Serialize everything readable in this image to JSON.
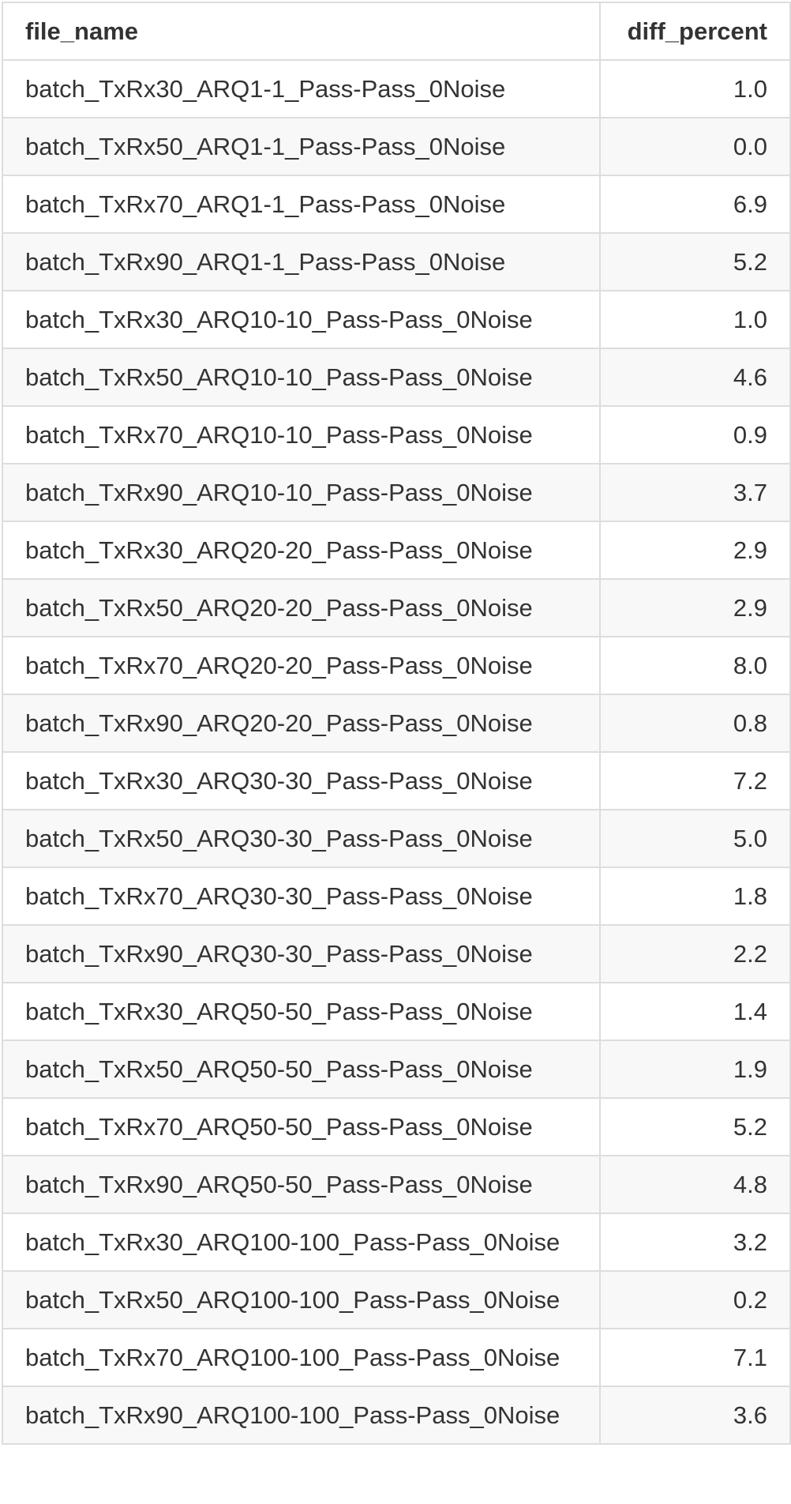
{
  "table": {
    "headers": {
      "file_name": "file_name",
      "diff_percent": "diff_percent"
    },
    "rows": [
      {
        "file_name": "batch_TxRx30_ARQ1-1_Pass-Pass_0Noise",
        "diff_percent": "1.0"
      },
      {
        "file_name": "batch_TxRx50_ARQ1-1_Pass-Pass_0Noise",
        "diff_percent": "0.0"
      },
      {
        "file_name": "batch_TxRx70_ARQ1-1_Pass-Pass_0Noise",
        "diff_percent": "6.9"
      },
      {
        "file_name": "batch_TxRx90_ARQ1-1_Pass-Pass_0Noise",
        "diff_percent": "5.2"
      },
      {
        "file_name": "batch_TxRx30_ARQ10-10_Pass-Pass_0Noise",
        "diff_percent": "1.0"
      },
      {
        "file_name": "batch_TxRx50_ARQ10-10_Pass-Pass_0Noise",
        "diff_percent": "4.6"
      },
      {
        "file_name": "batch_TxRx70_ARQ10-10_Pass-Pass_0Noise",
        "diff_percent": "0.9"
      },
      {
        "file_name": "batch_TxRx90_ARQ10-10_Pass-Pass_0Noise",
        "diff_percent": "3.7"
      },
      {
        "file_name": "batch_TxRx30_ARQ20-20_Pass-Pass_0Noise",
        "diff_percent": "2.9"
      },
      {
        "file_name": "batch_TxRx50_ARQ20-20_Pass-Pass_0Noise",
        "diff_percent": "2.9"
      },
      {
        "file_name": "batch_TxRx70_ARQ20-20_Pass-Pass_0Noise",
        "diff_percent": "8.0"
      },
      {
        "file_name": "batch_TxRx90_ARQ20-20_Pass-Pass_0Noise",
        "diff_percent": "0.8"
      },
      {
        "file_name": "batch_TxRx30_ARQ30-30_Pass-Pass_0Noise",
        "diff_percent": "7.2"
      },
      {
        "file_name": "batch_TxRx50_ARQ30-30_Pass-Pass_0Noise",
        "diff_percent": "5.0"
      },
      {
        "file_name": "batch_TxRx70_ARQ30-30_Pass-Pass_0Noise",
        "diff_percent": "1.8"
      },
      {
        "file_name": "batch_TxRx90_ARQ30-30_Pass-Pass_0Noise",
        "diff_percent": "2.2"
      },
      {
        "file_name": "batch_TxRx30_ARQ50-50_Pass-Pass_0Noise",
        "diff_percent": "1.4"
      },
      {
        "file_name": "batch_TxRx50_ARQ50-50_Pass-Pass_0Noise",
        "diff_percent": "1.9"
      },
      {
        "file_name": "batch_TxRx70_ARQ50-50_Pass-Pass_0Noise",
        "diff_percent": "5.2"
      },
      {
        "file_name": "batch_TxRx90_ARQ50-50_Pass-Pass_0Noise",
        "diff_percent": "4.8"
      },
      {
        "file_name": "batch_TxRx30_ARQ100-100_Pass-Pass_0Noise",
        "diff_percent": "3.2"
      },
      {
        "file_name": "batch_TxRx50_ARQ100-100_Pass-Pass_0Noise",
        "diff_percent": "0.2"
      },
      {
        "file_name": "batch_TxRx70_ARQ100-100_Pass-Pass_0Noise",
        "diff_percent": "7.1"
      },
      {
        "file_name": "batch_TxRx90_ARQ100-100_Pass-Pass_0Noise",
        "diff_percent": "3.6"
      }
    ]
  }
}
